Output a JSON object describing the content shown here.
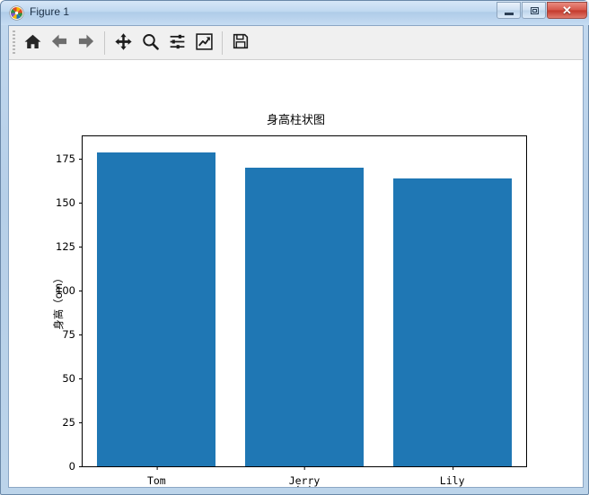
{
  "window": {
    "title": "Figure 1",
    "icon": "matplotlib-pinwheel-icon",
    "controls": {
      "minimize_label": "─",
      "maximize_label": "□",
      "close_label": "✕"
    }
  },
  "toolbar": {
    "buttons": [
      {
        "name": "home-button",
        "icon": "home-icon",
        "tooltip": "Reset original view"
      },
      {
        "name": "back-button",
        "icon": "arrow-left-icon",
        "tooltip": "Back to previous view"
      },
      {
        "name": "forward-button",
        "icon": "arrow-right-icon",
        "tooltip": "Forward to next view"
      },
      {
        "name": "pan-button",
        "icon": "move-arrows-icon",
        "tooltip": "Pan axes with left mouse, zoom with right"
      },
      {
        "name": "zoom-button",
        "icon": "magnifier-icon",
        "tooltip": "Zoom to rectangle"
      },
      {
        "name": "configure-subplots-button",
        "icon": "sliders-icon",
        "tooltip": "Configure subplots"
      },
      {
        "name": "edit-curves-button",
        "icon": "chart-line-icon",
        "tooltip": "Edit axis, curve and image parameters"
      },
      {
        "name": "save-button",
        "icon": "floppy-disk-icon",
        "tooltip": "Save the figure"
      }
    ]
  },
  "chart_data": {
    "type": "bar",
    "title": "身高柱状图",
    "xlabel": "名字",
    "ylabel": "身高（cm）",
    "categories": [
      "Tom",
      "Jerry",
      "Lily"
    ],
    "values": [
      179,
      170,
      164
    ],
    "bar_color": "#1f77b4",
    "ylim": [
      0,
      188
    ],
    "yticks": [
      0,
      25,
      50,
      75,
      100,
      125,
      150,
      175
    ],
    "ytick_labels": [
      "0",
      "25",
      "50",
      "75",
      "100",
      "125",
      "150",
      "175"
    ],
    "grid": false,
    "legend": null,
    "bar_width": 0.8
  }
}
